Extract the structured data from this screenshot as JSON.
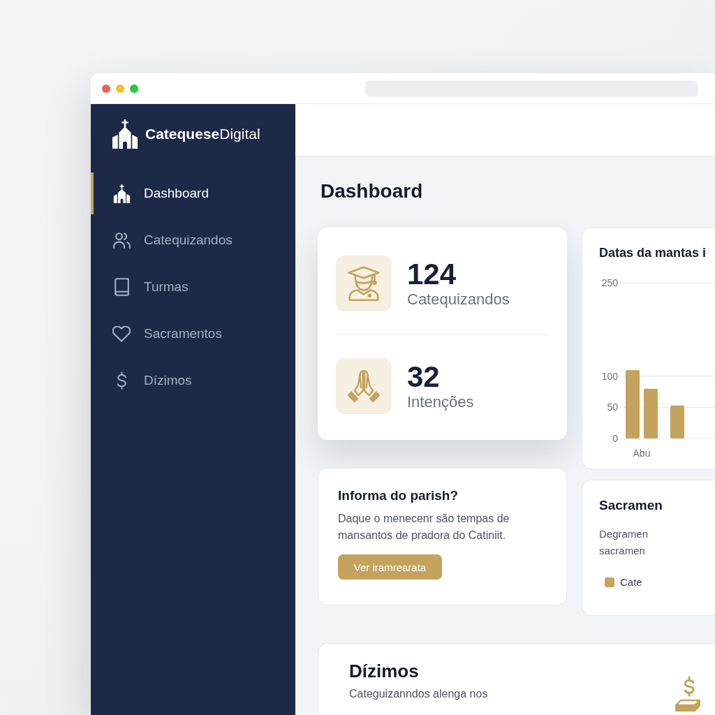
{
  "sidebar": {
    "brand": "**Catequese**Digital",
    "items": [
      {
        "label": "Dashboard",
        "selected": true
      },
      {
        "label": "Catequizandos",
        "selected": false
      },
      {
        "label": "Turmas",
        "selected": false
      },
      {
        "label": "Sacramentos",
        "selected": false
      },
      {
        "label": "Dízimos",
        "selected": false
      }
    ]
  },
  "page_title": "Dashboard",
  "stats": [
    {
      "value": "124",
      "label": "Catequizandos"
    },
    {
      "value": "32",
      "label": "Intenções"
    }
  ],
  "chart_card": {
    "chart_data": {
      "type": "bar",
      "title": "Datas da mantas i",
      "categories": [
        "Abu",
        null
      ],
      "series": [
        {
          "color": "#c4a35e",
          "values": [
            110,
            53
          ]
        },
        {
          "color": "#c4a35e",
          "values": [
            80,
            null
          ]
        }
      ],
      "ylim": [
        0,
        250
      ],
      "yticks": [
        0,
        50,
        100,
        250
      ]
    }
  },
  "info_card": {
    "title": "Informa do parish?",
    "text": "Daque o menecenr são tempas de mansantos de pradora do Catiniit.",
    "button": "Ver iramrearata"
  },
  "sacraments_card": {
    "title": "Sacramen",
    "lines": [
      "Degramen",
      "sacramen"
    ],
    "legend": [
      {
        "label": "Cate",
        "color": "#c4a35e"
      }
    ]
  },
  "tithes_card": {
    "title": "Dízimos",
    "text": "Categuizanndos alenga nos"
  }
}
